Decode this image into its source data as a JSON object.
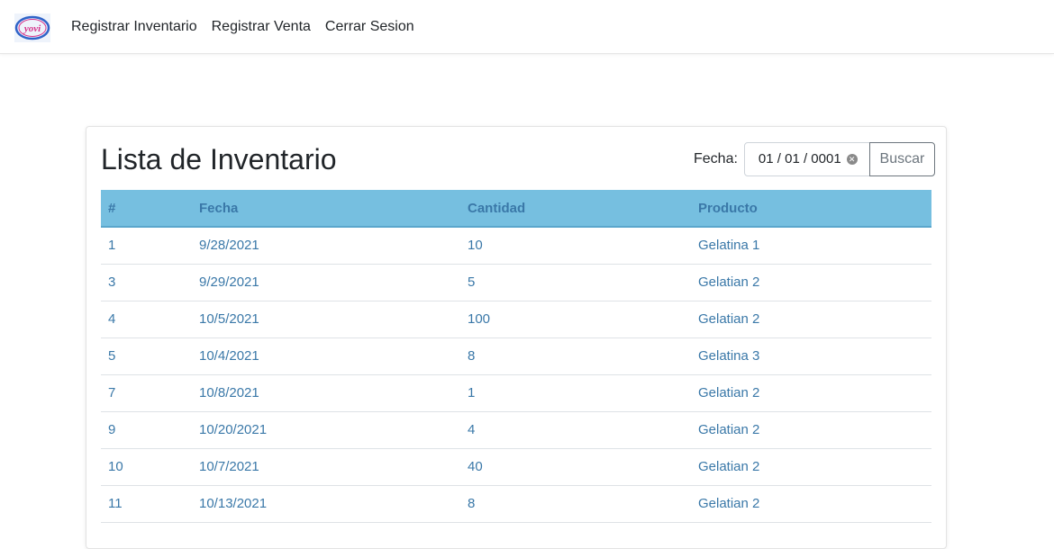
{
  "brand": {
    "logo_text": "yovi"
  },
  "nav": {
    "items": [
      {
        "label": "Registrar Inventario"
      },
      {
        "label": "Registrar Venta"
      },
      {
        "label": "Cerrar Sesion"
      }
    ]
  },
  "main": {
    "title": "Lista de Inventario",
    "filter": {
      "label": "Fecha:",
      "date_value": "01 / 01 / 0001",
      "search_button": "Buscar"
    },
    "table": {
      "headers": [
        "#",
        "Fecha",
        "Cantidad",
        "Producto"
      ],
      "rows": [
        [
          "1",
          "9/28/2021",
          "10",
          "Gelatina 1"
        ],
        [
          "3",
          "9/29/2021",
          "5",
          "Gelatian 2"
        ],
        [
          "4",
          "10/5/2021",
          "100",
          "Gelatian 2"
        ],
        [
          "5",
          "10/4/2021",
          "8",
          "Gelatina 3"
        ],
        [
          "7",
          "10/8/2021",
          "1",
          "Gelatian 2"
        ],
        [
          "9",
          "10/20/2021",
          "4",
          "Gelatian 2"
        ],
        [
          "10",
          "10/7/2021",
          "40",
          "Gelatian 2"
        ],
        [
          "11",
          "10/13/2021",
          "8",
          "Gelatian 2"
        ]
      ]
    }
  },
  "colors": {
    "header_bg": "#76bfe0",
    "link_text": "#3a78a8",
    "logo_ring": "#2f63c8",
    "logo_text": "#d6338a"
  }
}
